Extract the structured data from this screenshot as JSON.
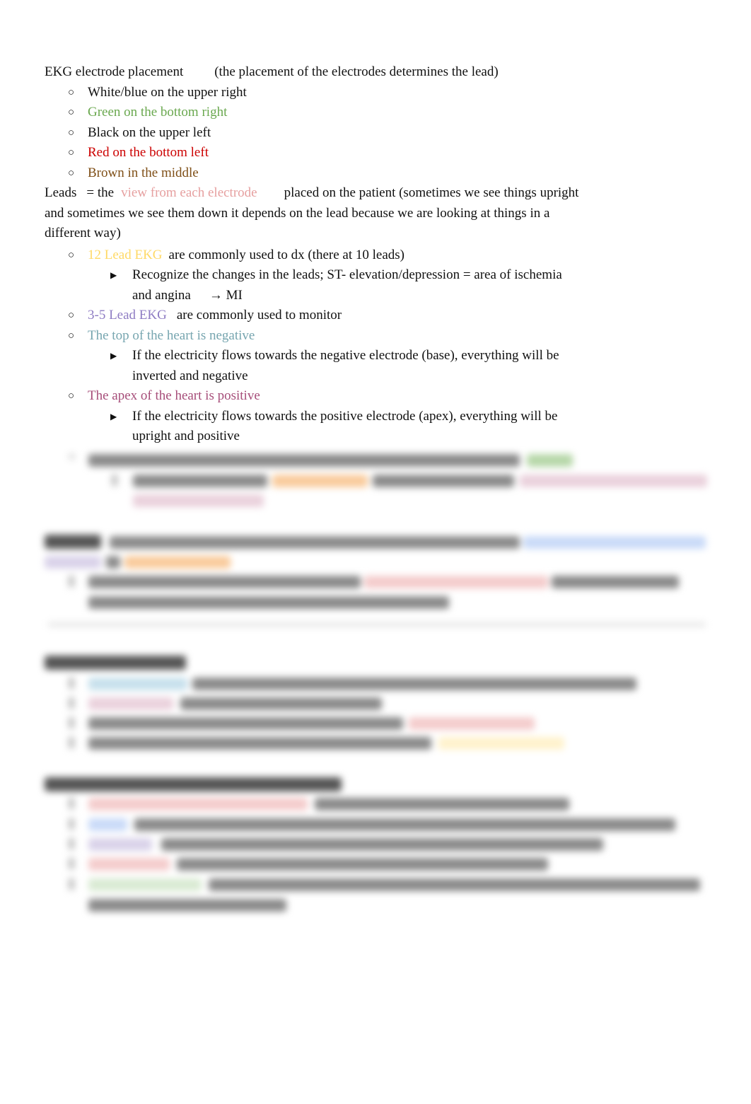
{
  "document": {
    "title": "EKG electrode placement",
    "title_note": "(the placement of the electrodes determines the lead)",
    "electrodes": [
      {
        "text": "White/blue on the upper right",
        "color": "#111111"
      },
      {
        "text": "Green on the bottom right",
        "color": "#6aa84f"
      },
      {
        "text": "Black on the upper left",
        "color": "#111111"
      },
      {
        "text": "Red on the bottom left",
        "color": "#cc0000"
      },
      {
        "text": "Brown in the middle",
        "color": "#7f4f17"
      }
    ],
    "leads_def": {
      "term": "Leads",
      "equals": "= the",
      "highlight": "view from each electrode",
      "highlight_color": "#e6a0a0",
      "line1_rest": "placed on the patient (sometimes we see things upright",
      "line2": "and sometimes we see them down it depends on the lead because we are looking at things in a",
      "line3": "different way)"
    },
    "items": [
      {
        "highlight": "12 Lead EKG",
        "color": "#ffd966",
        "rest": "are commonly used to dx (there at 10 leads)",
        "sub": {
          "line1": "Recognize the changes in the leads; ST- elevation/depression = area of ischemia",
          "line2a": "and angina",
          "arrow": "→",
          "line2b": "MI"
        }
      },
      {
        "highlight": "3-5 Lead EKG",
        "color": "#8e7cc3",
        "rest": "are commonly used to monitor"
      },
      {
        "highlight": "The top of the heart is negative",
        "color": "#76a5af",
        "rest": "",
        "sub": {
          "line1": "If the electricity flows towards the negative electrode (base), everything will be",
          "line2a": "inverted and negative"
        }
      },
      {
        "highlight": "The apex of the heart is positive",
        "color": "#a64d79",
        "rest": "",
        "sub": {
          "line1": "If the electricity flows towards the positive electrode (apex), everything will be",
          "line2a": "upright and positive"
        }
      }
    ],
    "bullets": {
      "circle": "○",
      "triangle": "▶"
    },
    "obscured_region": {
      "note": "remaining content is blurred",
      "accent_colors": [
        "#b6d7a8",
        "#f9cb9c",
        "#ead1dc",
        "#c9daf8",
        "#f4cccc",
        "#c7e0ec",
        "#fff2cc",
        "#d9d2e9",
        "#d9ead3"
      ]
    }
  }
}
